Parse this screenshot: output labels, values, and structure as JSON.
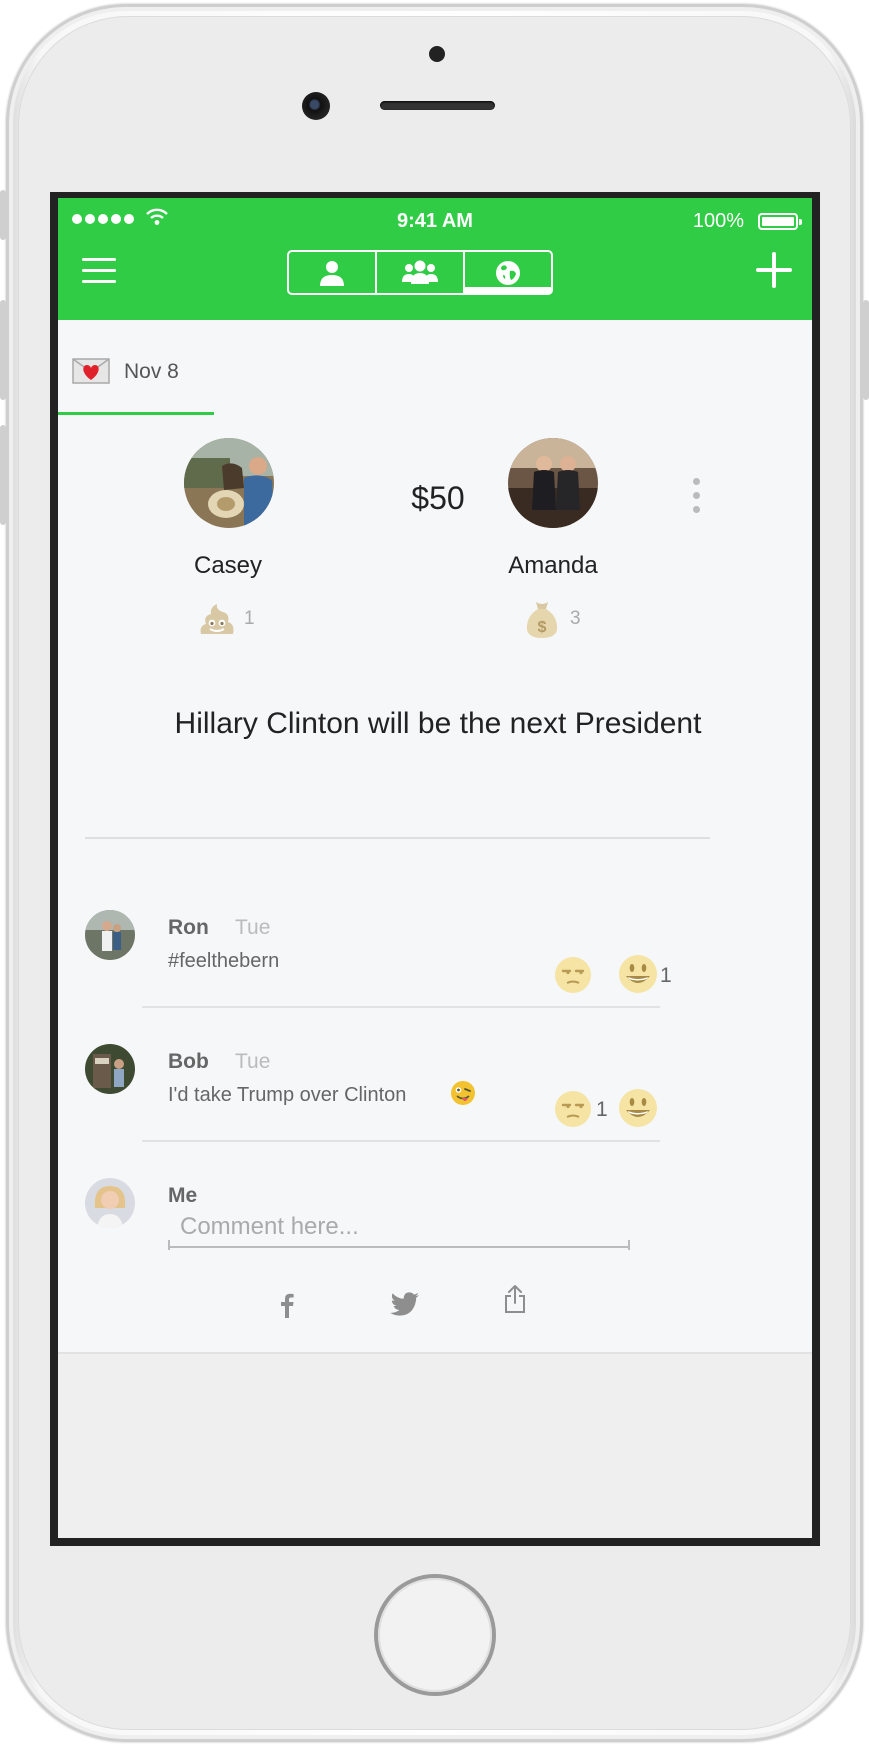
{
  "status_bar": {
    "time": "9:41 AM",
    "battery": "100%"
  },
  "header": {
    "tabs": [
      {
        "icon": "person-icon",
        "active": false
      },
      {
        "icon": "group-icon",
        "active": false
      },
      {
        "icon": "globe-icon",
        "active": true
      }
    ],
    "accent_color": "#31cc45"
  },
  "date_tab": {
    "label": "Nov 8",
    "icon": "love-letter-icon"
  },
  "bet": {
    "amount": "$50",
    "left_user": {
      "name": "Casey",
      "reaction_icon": "poop-emoji-icon",
      "reaction_count": "1"
    },
    "right_user": {
      "name": "Amanda",
      "reaction_icon": "money-bag-emoji-icon",
      "reaction_count": "3"
    },
    "question": "Hillary Clinton will be the next President"
  },
  "comments": [
    {
      "author": "Ron",
      "time": "Tue",
      "text": "#feelthebern",
      "unamused_count": "",
      "smiley_count": "1"
    },
    {
      "author": "Bob",
      "time": "Tue",
      "text": "I'd take Trump over Clinton",
      "unamused_count": "1",
      "smiley_count": ""
    }
  ],
  "composer": {
    "author": "Me",
    "placeholder": "Comment here..."
  },
  "share": [
    "facebook-icon",
    "twitter-icon",
    "share-icon"
  ]
}
